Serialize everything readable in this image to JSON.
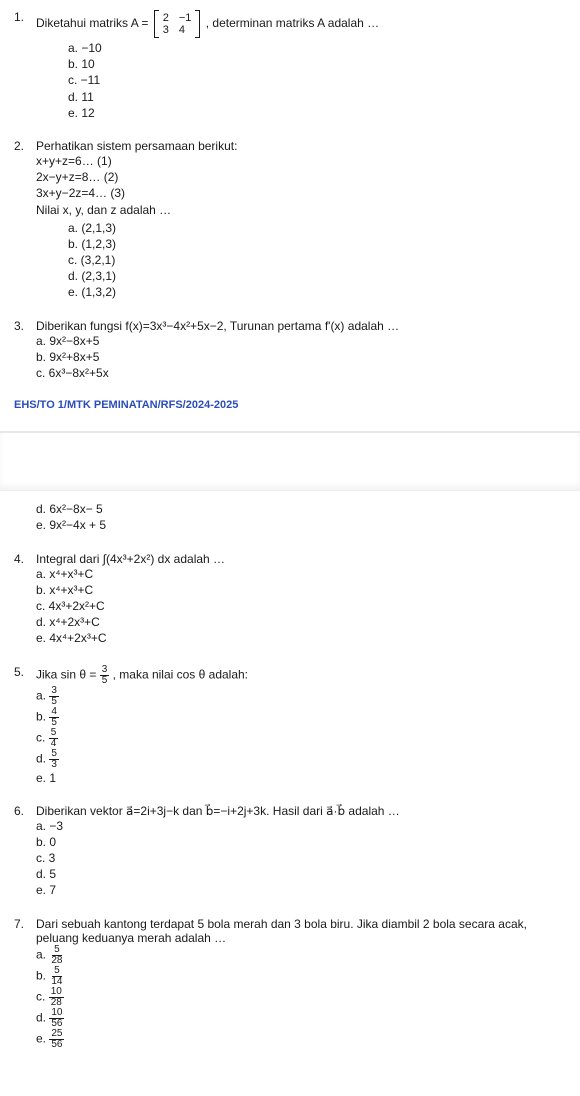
{
  "footer": "EHS/TO 1/MTK PEMINATAN/RFS/2024-2025",
  "q1": {
    "num": "1.",
    "pre": "Diketahui matriks A = ",
    "m": {
      "a": "2",
      "b": "−1",
      "c": "3",
      "d": "4"
    },
    "post": ", determinan matriks A adalah …",
    "opts": {
      "a": "a.   −10",
      "b": "b.   10",
      "c": "c.   −11",
      "d": "d.   11",
      "e": "e.   12"
    }
  },
  "q2": {
    "num": "2.",
    "stem": "Perhatikan sistem persamaan berikut:",
    "l1": "x+y+z=6… (1)",
    "l2": "2x−y+z=8… (2)",
    "l3": "3x+y−2z=4… (3)",
    "l4": "Nilai x, y, dan z adalah …",
    "opts": {
      "a": "a.   (2,1,3)",
      "b": "b.   (1,2,3)",
      "c": "c.   (3,2,1)",
      "d": "d.   (2,3,1)",
      "e": "e.   (1,3,2)"
    }
  },
  "q3": {
    "num": "3.",
    "stem": "Diberikan fungsi f(x)=3x³−4x²+5x−2, Turunan pertama f'(x) adalah …",
    "opts": {
      "a": "a. 9x²−8x+5",
      "b": "b. 9x²+8x+5",
      "c": "c. 6x³−8x²+5x"
    }
  },
  "q3c": {
    "opts": {
      "d": "d. 6x²−8x− 5",
      "e": "e. 9x²−4x + 5"
    }
  },
  "q4": {
    "num": "4.",
    "stem": "Integral dari ∫(4x³+2x²) dx adalah …",
    "opts": {
      "a": "a. x⁴+x³+C",
      "b": "b. x⁴+x³+C",
      "c": "c. 4x³+2x²+C",
      "d": "d. x⁴+2x³+C",
      "e": "e. 4x⁴+2x³+C"
    }
  },
  "q5": {
    "num": "5.",
    "pre": "Jika sin θ = ",
    "frac": {
      "n": "3",
      "d": "5"
    },
    "post": ", maka nilai cos θ adalah:",
    "opts": {
      "a": {
        "l": "a.",
        "n": "3",
        "d": "5"
      },
      "b": {
        "l": "b.",
        "n": "4",
        "d": "5"
      },
      "c": {
        "l": "c.",
        "n": "5",
        "d": "4"
      },
      "d": {
        "l": "d.",
        "n": "5",
        "d": "3"
      },
      "e": "e. 1"
    }
  },
  "q6": {
    "num": "6.",
    "stem": "Diberikan vektor a⃗=2i+3j−k dan b⃗=−i+2j+3k. Hasil dari  a⃗·b⃗ adalah …",
    "opts": {
      "a": "a. −3",
      "b": "b. 0",
      "c": "c. 3",
      "d": "d. 5",
      "e": "e. 7"
    }
  },
  "q7": {
    "num": "7.",
    "stem": "Dari sebuah kantong terdapat 5 bola merah dan 3 bola biru. Jika diambil 2 bola secara acak, peluang keduanya merah adalah …",
    "opts": {
      "a": {
        "l": "a.",
        "n": "5",
        "d": "28"
      },
      "b": {
        "l": "b.",
        "n": "5",
        "d": "14"
      },
      "c": {
        "l": "c.",
        "n": "10",
        "d": "28"
      },
      "d": {
        "l": "d.",
        "n": "10",
        "d": "56"
      },
      "e": {
        "l": "e.",
        "n": "25",
        "d": "56"
      }
    }
  }
}
